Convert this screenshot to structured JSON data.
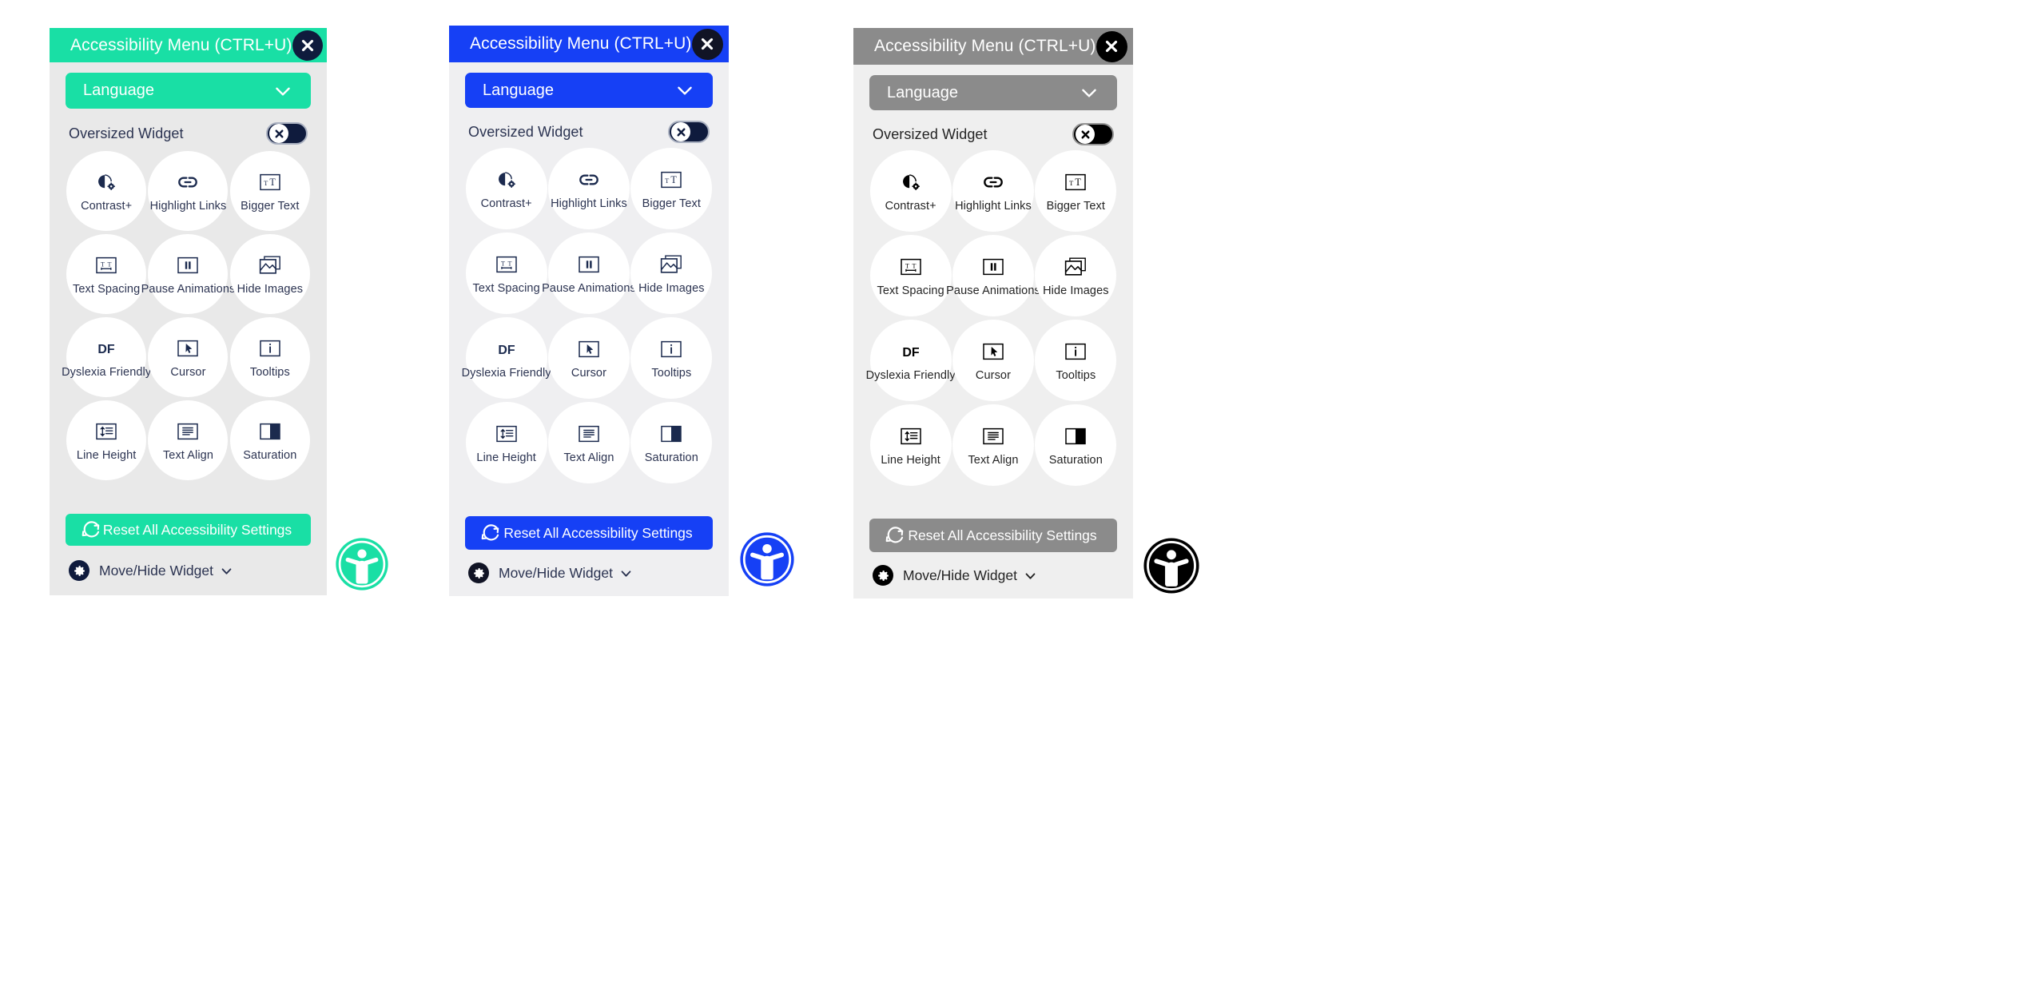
{
  "panels": [
    {
      "theme_name": "green",
      "accent": "#19DFA5",
      "icon_color": "#1B2A4E",
      "text_color": "#2B3351",
      "header": {
        "title": "Accessibility Menu (CTRL+U)",
        "close_icon": "close-icon"
      },
      "language": {
        "label": "Language",
        "chevron_icon": "chevron-down-icon"
      },
      "oversized": {
        "label": "Oversized Widget",
        "state": "off",
        "knob_icon": "x-icon"
      },
      "features": [
        {
          "label": "Contrast+",
          "icon": "contrast-icon"
        },
        {
          "label": "Highlight Links",
          "icon": "link-icon"
        },
        {
          "label": "Bigger Text",
          "icon": "bigger-text-icon"
        },
        {
          "label": "Text Spacing",
          "icon": "text-spacing-icon"
        },
        {
          "label": "Pause Animations",
          "icon": "pause-icon"
        },
        {
          "label": "Hide Images",
          "icon": "image-icon"
        },
        {
          "label": "Dyslexia Friendly",
          "icon": "dyslexia-df-icon"
        },
        {
          "label": "Cursor",
          "icon": "cursor-icon"
        },
        {
          "label": "Tooltips",
          "icon": "info-icon"
        },
        {
          "label": "Line Height",
          "icon": "line-height-icon"
        },
        {
          "label": "Text Align",
          "icon": "text-align-icon"
        },
        {
          "label": "Saturation",
          "icon": "saturation-icon"
        }
      ],
      "reset": {
        "label": "Reset All Accessibility Settings",
        "icon": "refresh-icon"
      },
      "move_hide": {
        "label": "Move/Hide Widget",
        "gear_icon": "gear-icon",
        "chevron_icon": "chevron-down-icon"
      },
      "launcher": {
        "icon": "accessibility-person-icon",
        "color": "#19DFA5"
      }
    },
    {
      "theme_name": "blue",
      "accent": "#1640F5",
      "icon_color": "#1B2A4E",
      "text_color": "#2B3351",
      "header": {
        "title": "Accessibility Menu (CTRL+U)",
        "close_icon": "close-icon"
      },
      "language": {
        "label": "Language",
        "chevron_icon": "chevron-down-icon"
      },
      "oversized": {
        "label": "Oversized Widget",
        "state": "off",
        "knob_icon": "x-icon"
      },
      "features": [
        {
          "label": "Contrast+",
          "icon": "contrast-icon"
        },
        {
          "label": "Highlight Links",
          "icon": "link-icon"
        },
        {
          "label": "Bigger Text",
          "icon": "bigger-text-icon"
        },
        {
          "label": "Text Spacing",
          "icon": "text-spacing-icon"
        },
        {
          "label": "Pause Animations",
          "icon": "pause-icon"
        },
        {
          "label": "Hide Images",
          "icon": "image-icon"
        },
        {
          "label": "Dyslexia Friendly",
          "icon": "dyslexia-df-icon"
        },
        {
          "label": "Cursor",
          "icon": "cursor-icon"
        },
        {
          "label": "Tooltips",
          "icon": "info-icon"
        },
        {
          "label": "Line Height",
          "icon": "line-height-icon"
        },
        {
          "label": "Text Align",
          "icon": "text-align-icon"
        },
        {
          "label": "Saturation",
          "icon": "saturation-icon"
        }
      ],
      "reset": {
        "label": "Reset All Accessibility Settings",
        "icon": "refresh-icon"
      },
      "move_hide": {
        "label": "Move/Hide Widget",
        "gear_icon": "gear-icon",
        "chevron_icon": "chevron-down-icon"
      },
      "launcher": {
        "icon": "accessibility-person-icon",
        "color": "#1640F5"
      }
    },
    {
      "theme_name": "grayscale",
      "accent": "#8B8B8B",
      "icon_color": "#000000",
      "text_color": "#242424",
      "header": {
        "title": "Accessibility Menu (CTRL+U)",
        "close_icon": "close-icon"
      },
      "language": {
        "label": "Language",
        "chevron_icon": "chevron-down-icon"
      },
      "oversized": {
        "label": "Oversized Widget",
        "state": "off",
        "knob_icon": "x-icon"
      },
      "features": [
        {
          "label": "Contrast+",
          "icon": "contrast-icon"
        },
        {
          "label": "Highlight Links",
          "icon": "link-icon"
        },
        {
          "label": "Bigger Text",
          "icon": "bigger-text-icon"
        },
        {
          "label": "Text Spacing",
          "icon": "text-spacing-icon"
        },
        {
          "label": "Pause Animations",
          "icon": "pause-icon"
        },
        {
          "label": "Hide Images",
          "icon": "image-icon"
        },
        {
          "label": "Dyslexia Friendly",
          "icon": "dyslexia-df-icon"
        },
        {
          "label": "Cursor",
          "icon": "cursor-icon"
        },
        {
          "label": "Tooltips",
          "icon": "info-icon"
        },
        {
          "label": "Line Height",
          "icon": "line-height-icon"
        },
        {
          "label": "Text Align",
          "icon": "text-align-icon"
        },
        {
          "label": "Saturation",
          "icon": "saturation-icon"
        }
      ],
      "reset": {
        "label": "Reset All Accessibility Settings",
        "icon": "refresh-icon"
      },
      "move_hide": {
        "label": "Move/Hide Widget",
        "gear_icon": "gear-icon",
        "chevron_icon": "chevron-down-icon"
      },
      "launcher": {
        "icon": "accessibility-person-icon",
        "color": "#000000"
      }
    }
  ]
}
